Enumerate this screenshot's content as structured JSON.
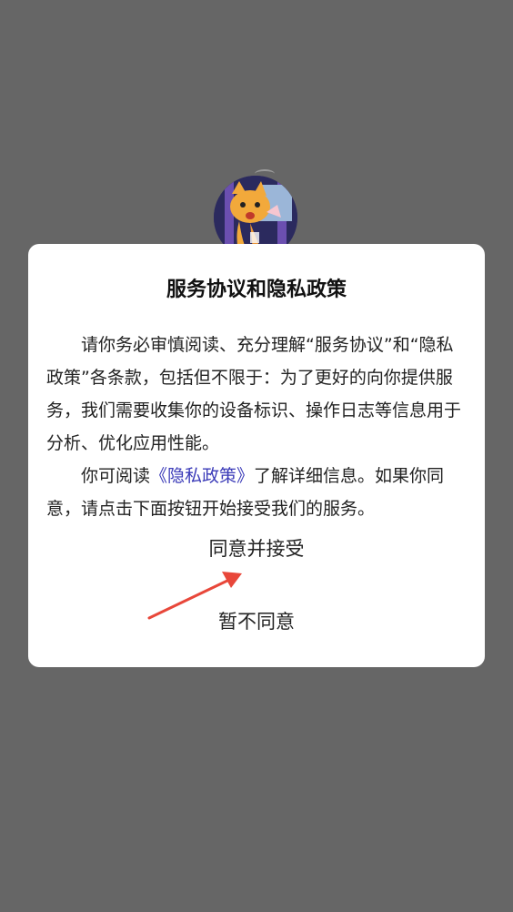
{
  "dialog": {
    "title": "服务协议和隐私政策",
    "para1": "请你务必审慎阅读、充分理解“服务协议”和“隐私政策”各条款，包括但不限于：为了更好的向你提供服务，我们需要收集你的设备标识、操作日志等信息用于分析、优化应用性能。",
    "para2_before": "你可阅读",
    "para2_link": "《隐私政策》",
    "para2_after": "了解详细信息。如果你同意，请点击下面按钮开始接受我们的服务。",
    "agree_label": "同意并接受",
    "disagree_label": "暂不同意"
  },
  "colors": {
    "overlay": "#666666",
    "link": "#3a3ab8",
    "arrow": "#e8473a"
  },
  "icons": {
    "avatar": "cat-avatar-icon",
    "annotation": "red-arrow-icon"
  }
}
